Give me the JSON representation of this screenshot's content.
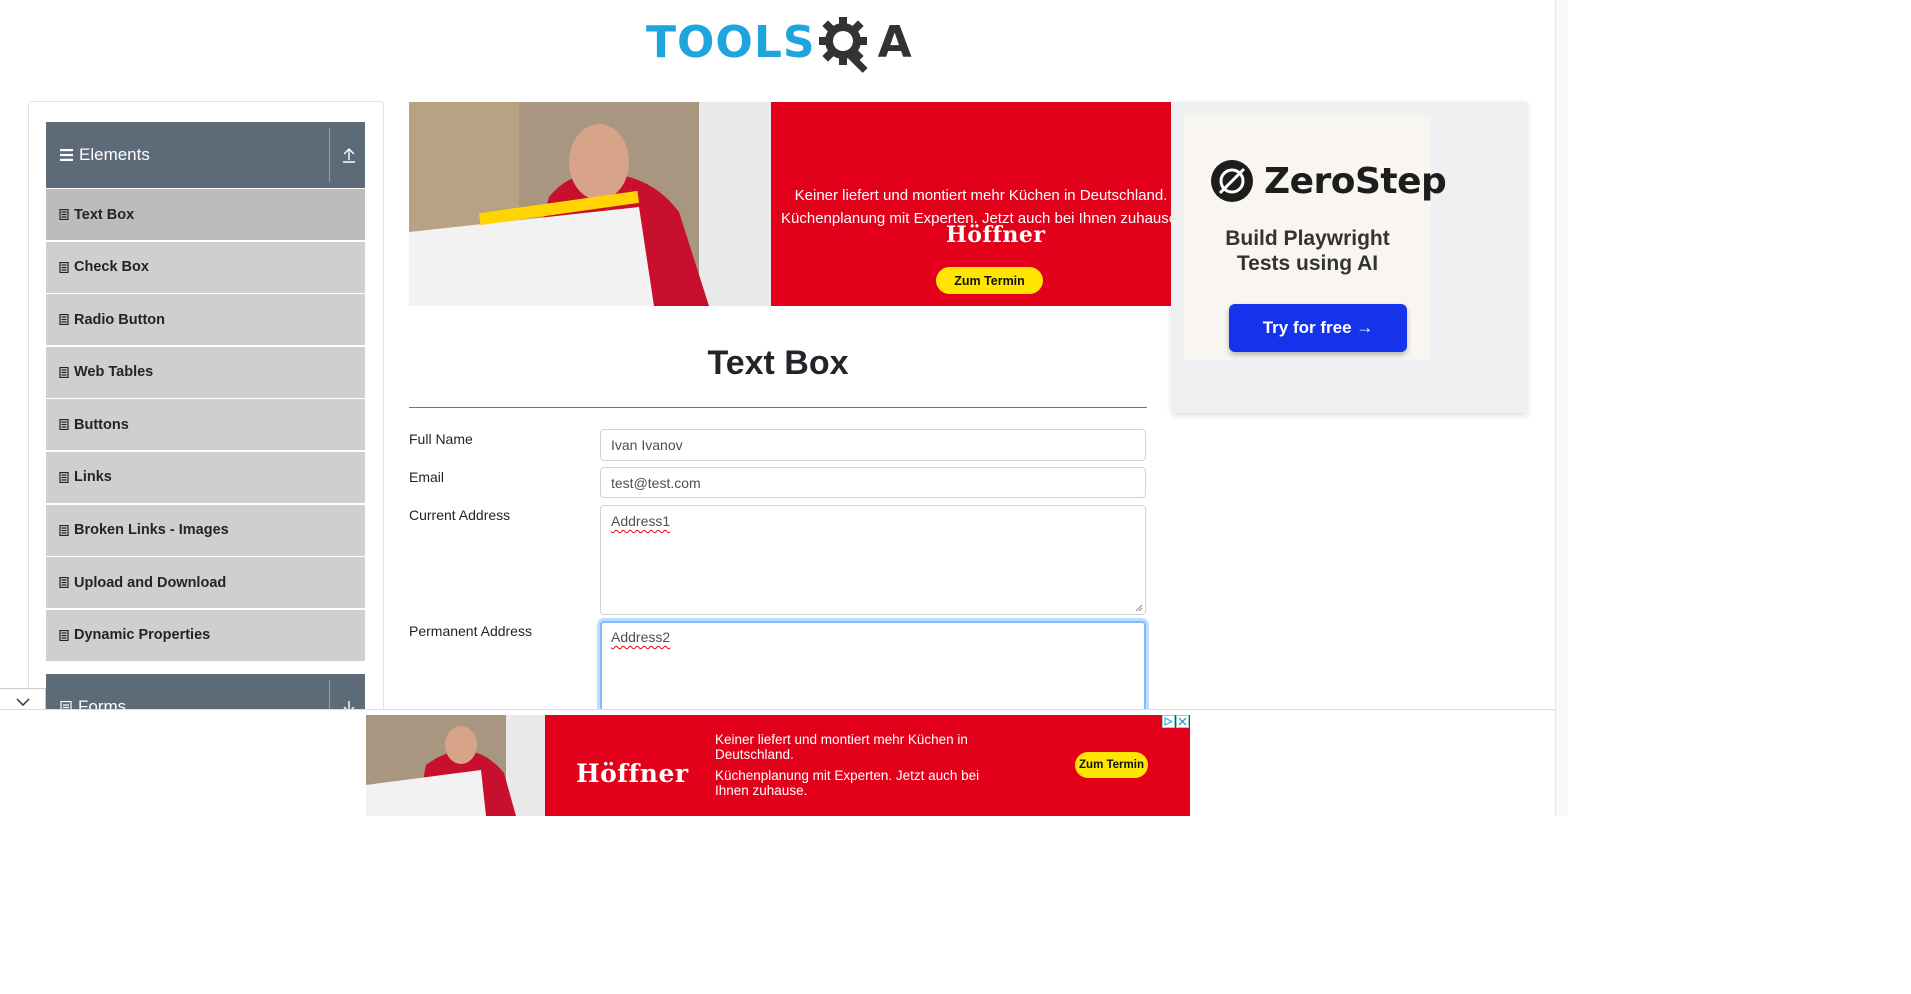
{
  "header": {
    "logo_text_left": "TOOLS",
    "logo_text_right": "A"
  },
  "sidebar": {
    "groups": [
      {
        "label": "Elements",
        "expanded": true
      },
      {
        "label": "Forms",
        "expanded": false
      }
    ],
    "items": [
      {
        "label": "Text Box",
        "active": true
      },
      {
        "label": "Check Box"
      },
      {
        "label": "Radio Button"
      },
      {
        "label": "Web Tables"
      },
      {
        "label": "Buttons"
      },
      {
        "label": "Links"
      },
      {
        "label": "Broken Links - Images"
      },
      {
        "label": "Upload and Download"
      },
      {
        "label": "Dynamic Properties"
      }
    ]
  },
  "ad_top": {
    "brand": "Höffner",
    "line1": "Keiner liefert und montiert mehr Küchen in Deutschland.",
    "line2": "Küchenplanung mit Experten. Jetzt auch bei Ihnen zuhause.",
    "cta": "Zum Termin"
  },
  "ad_right": {
    "brand": "ZeroStep",
    "tagline_1": "Build Playwright",
    "tagline_2": "Tests using AI",
    "cta": "Try for free →"
  },
  "main": {
    "title": "Text Box",
    "fields": {
      "full_name": {
        "label": "Full Name",
        "value": "Ivan Ivanov"
      },
      "email": {
        "label": "Email",
        "value": "test@test.com"
      },
      "current_address": {
        "label": "Current Address",
        "value": "Address1"
      },
      "permanent_address": {
        "label": "Permanent Address",
        "value": "Address2"
      }
    }
  },
  "ad_bottom": {
    "brand": "Höffner",
    "line1": "Keiner liefert und montiert mehr Küchen in Deutschland.",
    "line2": "Küchenplanung mit Experten. Jetzt auch bei Ihnen zuhause.",
    "cta": "Zum Termin"
  },
  "colors": {
    "brand_blue": "#1fa5dd",
    "sidebar_header": "#5d6b78",
    "menu_item_bg": "#cfcfcf",
    "ad_red": "#e2001a",
    "ad_yellow": "#ffe500",
    "zerostep_blue": "#1433ea"
  }
}
